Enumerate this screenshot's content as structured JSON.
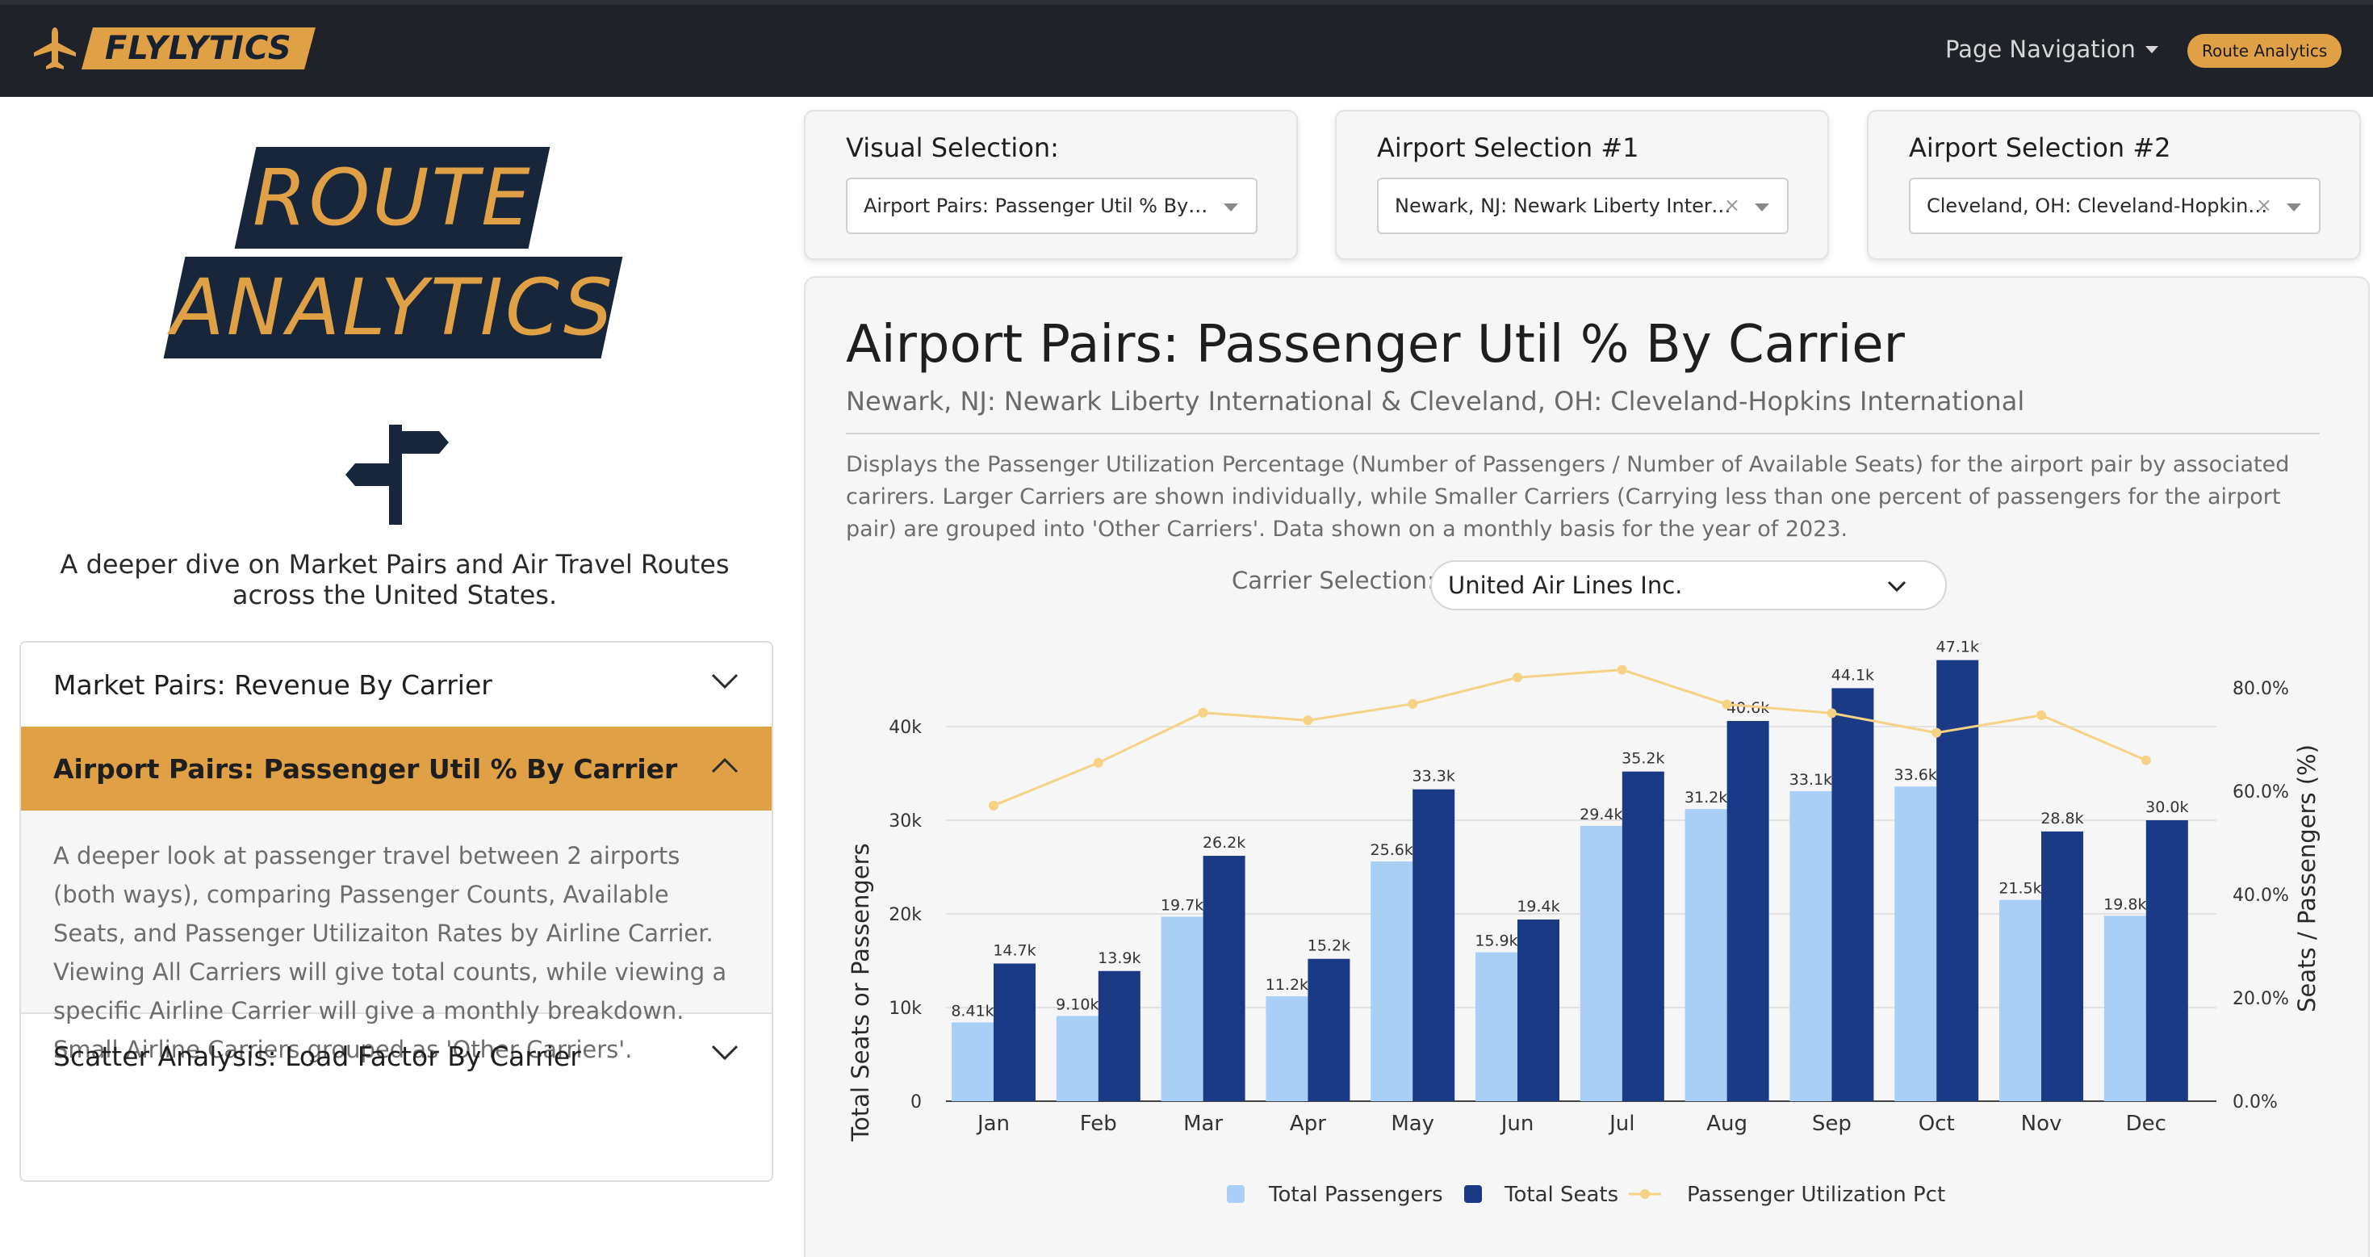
{
  "navbar": {
    "brand": "FLYLYTICS",
    "brand_icon": "airplane-icon",
    "menu_label": "Page Navigation",
    "active_page": "Route Analytics"
  },
  "sidebar": {
    "title_line1": "ROUTE",
    "title_line2": "ANALYTICS",
    "icon": "signpost-icon",
    "tagline": "A deeper dive on Market Pairs and Air Travel Routes across the United States.",
    "accordion": [
      {
        "label": "Market Pairs: Revenue By Carrier",
        "expanded": false
      },
      {
        "label": "Airport Pairs: Passenger Util % By Carrier",
        "expanded": true,
        "body": "A deeper look at passenger travel between 2 airports (both ways), comparing Passenger Counts, Available Seats, and Passenger Utilizaiton Rates by Airline Carrier. Viewing All Carriers will give total counts, while viewing a specific Airline Carrier will give a monthly breakdown. Small Airline Carriers grouped as 'Other Carriers'."
      },
      {
        "label": "Scatter Analysis: Load Factor By Carrier",
        "expanded": false
      }
    ]
  },
  "selectors": {
    "visual": {
      "label": "Visual Selection:",
      "value": "Airport Pairs: Passenger Util % By Carr..."
    },
    "airport1": {
      "label": "Airport Selection #1",
      "value": "Newark, NJ: Newark Liberty Internatio..."
    },
    "airport2": {
      "label": "Airport Selection #2",
      "value": "Cleveland, OH: Cleveland-Hopkins Inte..."
    },
    "clear_glyph": "×"
  },
  "panel": {
    "title": "Airport Pairs: Passenger Util % By Carrier",
    "subtitle": "Newark, NJ: Newark Liberty International & Cleveland, OH: Cleveland-Hopkins International",
    "description": "Displays the Passenger Utilization Percentage (Number of Passengers / Number of Available Seats) for the airport pair by associated carirers. Larger Carriers are shown individually, while Smaller Carriers (Carrying less than one percent of passengers for the airport pair) are grouped into 'Other Carriers'. Data shown on a monthly basis for the year of 2023.",
    "carrier_label": "Carrier Selection:",
    "carrier_value": "United Air Lines Inc."
  },
  "colors": {
    "navbar": "#1f2228",
    "accent": "#e0a046",
    "title_block": "#17263a",
    "passengers": "#a9cff7",
    "seats": "#1a3a85",
    "util": "#f5d284"
  },
  "chart_data": {
    "type": "bar",
    "categories": [
      "Jan",
      "Feb",
      "Mar",
      "Apr",
      "May",
      "Jun",
      "Jul",
      "Aug",
      "Sep",
      "Oct",
      "Nov",
      "Dec"
    ],
    "series": [
      {
        "name": "Total Passengers",
        "type": "bar",
        "axis": "left",
        "values": [
          8410,
          9100,
          19700,
          11200,
          25600,
          15900,
          29400,
          31200,
          33100,
          33600,
          21500,
          19800
        ],
        "labels": [
          "8.41k",
          "9.10k",
          "19.7k",
          "11.2k",
          "25.6k",
          "15.9k",
          "29.4k",
          "31.2k",
          "33.1k",
          "33.6k",
          "21.5k",
          "19.8k"
        ]
      },
      {
        "name": "Total Seats",
        "type": "bar",
        "axis": "left",
        "values": [
          14700,
          13900,
          26200,
          15200,
          33300,
          19400,
          35200,
          40600,
          44100,
          47100,
          28800,
          30000
        ],
        "labels": [
          "14.7k",
          "13.9k",
          "26.2k",
          "15.2k",
          "33.3k",
          "19.4k",
          "35.2k",
          "40.6k",
          "44.1k",
          "47.1k",
          "28.8k",
          "30.0k"
        ]
      },
      {
        "name": "Passenger Utilization Pct",
        "type": "line",
        "axis": "right",
        "values": [
          57.2,
          65.5,
          75.2,
          73.7,
          76.9,
          82.0,
          83.5,
          76.8,
          75.1,
          71.3,
          74.7,
          66.0
        ]
      }
    ],
    "ylabel": "Total Seats or Passengers",
    "y2label": "Seats / Passengers (%)",
    "ylim": [
      0,
      48000
    ],
    "y2lim": [
      0,
      87.0
    ],
    "yticks": [
      "0",
      "10k",
      "20k",
      "30k",
      "40k"
    ],
    "y2ticks": [
      "0.0%",
      "20.0%",
      "40.0%",
      "60.0%",
      "80.0%"
    ],
    "grid": true,
    "legend": "bottom-center"
  }
}
